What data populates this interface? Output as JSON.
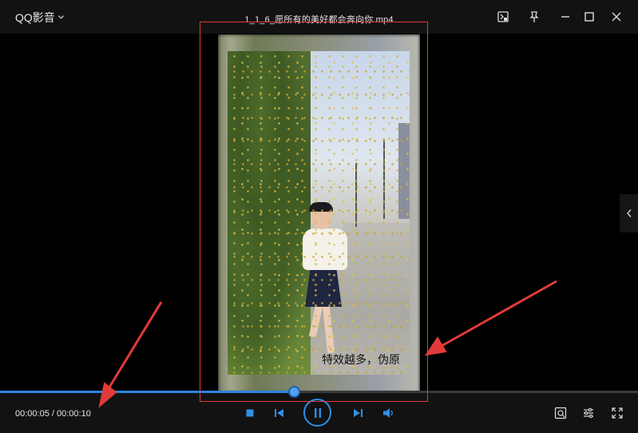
{
  "app": {
    "brand_label": "QQ影音",
    "brand_menu_icon": "chevron-down-icon"
  },
  "title_bar": {
    "file_title": "1_1_6_愿所有的美好都会奔向你.mp4",
    "buttons": [
      {
        "name": "screenshot-window-button",
        "icon": "picture-frame-icon"
      },
      {
        "name": "pin-button",
        "icon": "pin-icon"
      },
      {
        "name": "minimize-button",
        "icon": "minimize-icon"
      },
      {
        "name": "maximize-button",
        "icon": "maximize-icon"
      },
      {
        "name": "close-button",
        "icon": "close-icon"
      }
    ]
  },
  "video": {
    "subtitle": "特效越多，伪原",
    "colors": {
      "annotation": "#e23a3a"
    }
  },
  "playback": {
    "current_time": "00:00:05",
    "total_time": "00:00:10",
    "separator": " / ",
    "progress_fraction": 0.46,
    "accent_color": "#2d84e0",
    "controls": [
      "stop-icon",
      "previous-icon",
      "pause-icon",
      "next-icon",
      "volume-icon"
    ],
    "right_controls": [
      "screenshot-icon",
      "settings-icon",
      "fullscreen-icon"
    ]
  },
  "side_panel": {
    "toggle_icon": "chevron-left-icon"
  }
}
